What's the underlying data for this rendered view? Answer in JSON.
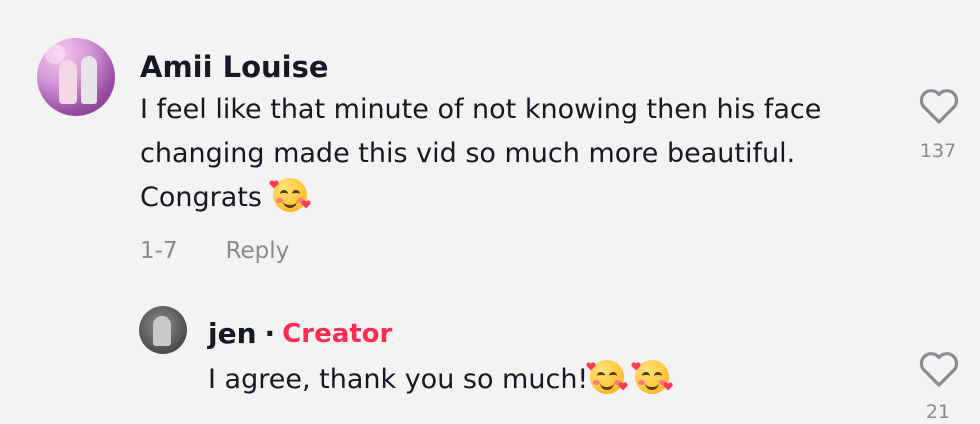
{
  "comment": {
    "author": "Amii Louise",
    "text_line1": "I feel like that minute of not knowing then his face",
    "text_line2": "changing made this vid so much more beautiful.",
    "text_line3": "Congrats",
    "date": "1-7",
    "reply_label": "Reply",
    "like_count": "137"
  },
  "reply": {
    "author": "jen",
    "separator": "·",
    "badge": "Creator",
    "text": "I agree, thank you so much!",
    "like_count": "21"
  },
  "icons": {
    "like": "heart-outline-icon",
    "emoji": "smiling-face-with-hearts"
  },
  "colors": {
    "background": "#f3f3f3",
    "text": "#161823",
    "secondary": "#8a8b91",
    "creator": "#fe2c55"
  }
}
